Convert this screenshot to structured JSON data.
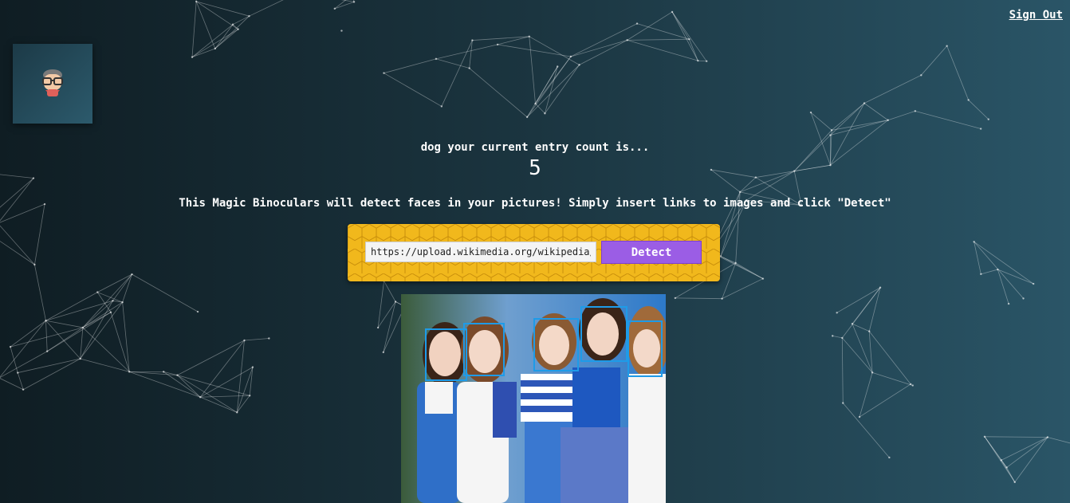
{
  "header": {
    "sign_out_label": "Sign Out"
  },
  "logo": {
    "icon": "nerd-avatar-icon"
  },
  "entry": {
    "label": "dog your current entry count is...",
    "count": "5"
  },
  "description": "This Magic Binoculars will detect faces in your pictures! Simply insert links to images and click \"Detect\"",
  "form": {
    "url_value": "https://upload.wikimedia.org/wikipedia/",
    "detect_label": "Detect"
  },
  "result": {
    "faces_detected": 5
  },
  "colors": {
    "accent": "#9b5de5",
    "form_bg": "#f1b81c",
    "face_box": "#1e9be8"
  }
}
